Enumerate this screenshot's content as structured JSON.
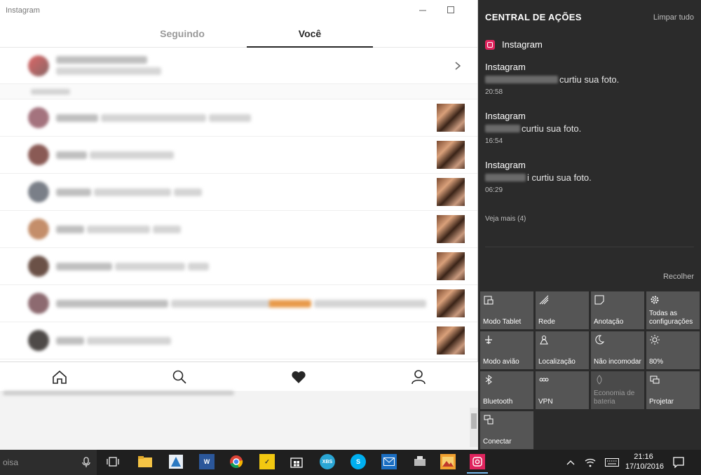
{
  "window": {
    "title": "Instagram"
  },
  "tabs": [
    {
      "label": "Seguindo"
    },
    {
      "label": "Você"
    }
  ],
  "notifications_count": 7,
  "action_center": {
    "title": "CENTRAL DE AÇÕES",
    "clear_all": "Limpar tudo",
    "app_name": "Instagram",
    "notifications": [
      {
        "title": "Instagram",
        "text": "curtiu sua foto.",
        "time": "20:58"
      },
      {
        "title": "Instagram",
        "text": "curtiu sua foto.",
        "time": "16:54"
      },
      {
        "title": "Instagram",
        "text": "i curtiu sua foto.",
        "time": "06:29"
      }
    ],
    "see_more": "Veja mais (4)",
    "collapse": "Recolher",
    "quick_actions": [
      {
        "label": "Modo Tablet",
        "icon": "tablet-mode-icon",
        "enabled": true
      },
      {
        "label": "Rede",
        "icon": "network-icon",
        "enabled": true
      },
      {
        "label": "Anotação",
        "icon": "note-icon",
        "enabled": true
      },
      {
        "label": "Todas as configurações",
        "icon": "settings-icon",
        "enabled": true
      },
      {
        "label": "Modo avião",
        "icon": "airplane-icon",
        "enabled": true
      },
      {
        "label": "Localização",
        "icon": "location-icon",
        "enabled": true
      },
      {
        "label": "Não incomodar",
        "icon": "moon-icon",
        "enabled": true
      },
      {
        "label": "80%",
        "icon": "brightness-icon",
        "enabled": true
      },
      {
        "label": "Bluetooth",
        "icon": "bluetooth-icon",
        "enabled": true
      },
      {
        "label": "VPN",
        "icon": "vpn-icon",
        "enabled": true
      },
      {
        "label": "Economia de bateria",
        "icon": "battery-saver-icon",
        "enabled": false
      },
      {
        "label": "Projetar",
        "icon": "project-icon",
        "enabled": true
      },
      {
        "label": "Conectar",
        "icon": "connect-icon",
        "enabled": true
      }
    ]
  },
  "taskbar": {
    "search_text": "oisa",
    "time": "21:16",
    "date": "17/10/2016",
    "colors": {
      "bar": "#1f1f1f",
      "instagram": "#e0245e"
    }
  }
}
